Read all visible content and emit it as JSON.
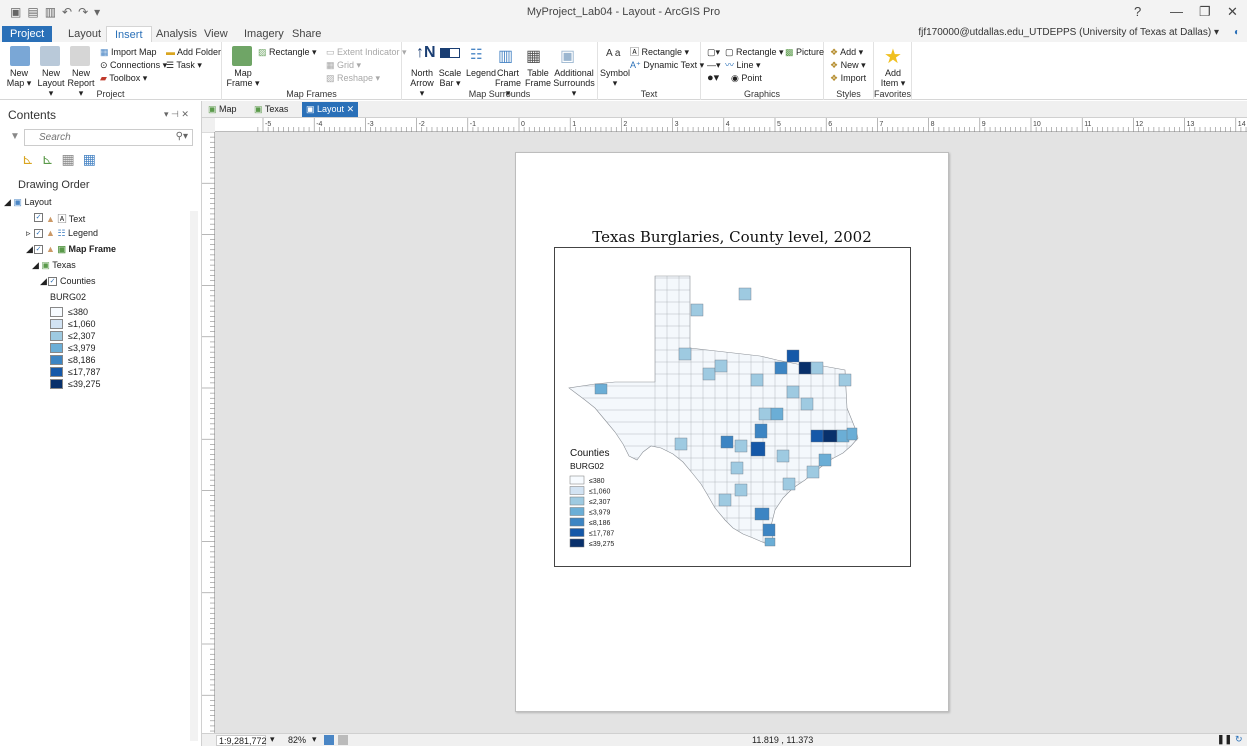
{
  "window": {
    "title": "MyProject_Lab04 - Layout - ArcGIS Pro",
    "help": "?",
    "minimize": "—",
    "restore": "❐",
    "close": "✕"
  },
  "ribbon_tabs": [
    "Project",
    "Layout",
    "Insert",
    "Analysis",
    "View",
    "Imagery",
    "Share"
  ],
  "user": "fjf170000@utdallas.edu_UTDEPPS (University of Texas at Dallas) ▾",
  "ribbon": {
    "project": {
      "label": "Project",
      "new_map": "New Map ▾",
      "new_layout": "New Layout ▾",
      "new_report": "New Report ▾",
      "import_map": "Import Map",
      "add_folder": "Add Folder",
      "connections": "Connections ▾",
      "task": "Task ▾",
      "toolbox": "Toolbox ▾"
    },
    "map_frames": {
      "label": "Map Frames",
      "map_frame": "Map Frame ▾",
      "rectangle": "Rectangle ▾",
      "extent_indicator": "Extent Indicator ▾",
      "grid": "Grid ▾",
      "reshape": "Reshape ▾"
    },
    "map_surrounds": {
      "label": "Map Surrounds",
      "north_arrow": "North Arrow ▾",
      "scale_bar": "Scale Bar ▾",
      "legend": "Legend",
      "chart_frame": "Chart Frame ▾",
      "table_frame": "Table Frame",
      "additional": "Additional Surrounds ▾"
    },
    "text": {
      "label": "Text",
      "symbol": "Symbol ▾",
      "rectangle": "Rectangle ▾",
      "dynamic_text": "Dynamic Text ▾"
    },
    "graphics": {
      "label": "Graphics",
      "rectangle": "Rectangle ▾",
      "picture": "Picture",
      "line": "Line ▾",
      "point": "Point"
    },
    "styles": {
      "label": "Styles",
      "add": "Add ▾",
      "new": "New ▾",
      "import": "Import"
    },
    "favorites": {
      "label": "Favorites",
      "add_item": "Add Item ▾"
    }
  },
  "contents": {
    "title": "Contents",
    "pane_controls": "▾ ⊣ ✕",
    "search_placeholder": "Search",
    "drawing_order": "Drawing Order",
    "tree": {
      "layout": "Layout",
      "text": "Text",
      "legend": "Legend",
      "map_frame": "Map Frame",
      "texas": "Texas",
      "counties": "Counties",
      "field": "BURG02"
    },
    "classes": [
      "≤380",
      "≤1,060",
      "≤2,307",
      "≤3,979",
      "≤8,186",
      "≤17,787",
      "≤39,275"
    ]
  },
  "class_colors": [
    "#f7fbff",
    "#d2e3f3",
    "#9ecae1",
    "#6baed6",
    "#3d85c3",
    "#1558a8",
    "#08306b"
  ],
  "doc_tabs": [
    "Map",
    "Texas",
    "Layout"
  ],
  "ruler_labels": [
    "-5",
    "-4",
    "-3",
    "-2",
    "-1",
    "0",
    "1",
    "2",
    "3",
    "4",
    "5",
    "6",
    "7",
    "8",
    "9",
    "10",
    "11",
    "12",
    "13",
    "14"
  ],
  "layout": {
    "map_title": "Texas Burglaries, County level, 2002",
    "legend": {
      "title": "Counties",
      "field": "BURG02"
    }
  },
  "status": {
    "scale": "1:9,281,772",
    "zoom": "82%",
    "coords": "11.819 , 11.373"
  }
}
